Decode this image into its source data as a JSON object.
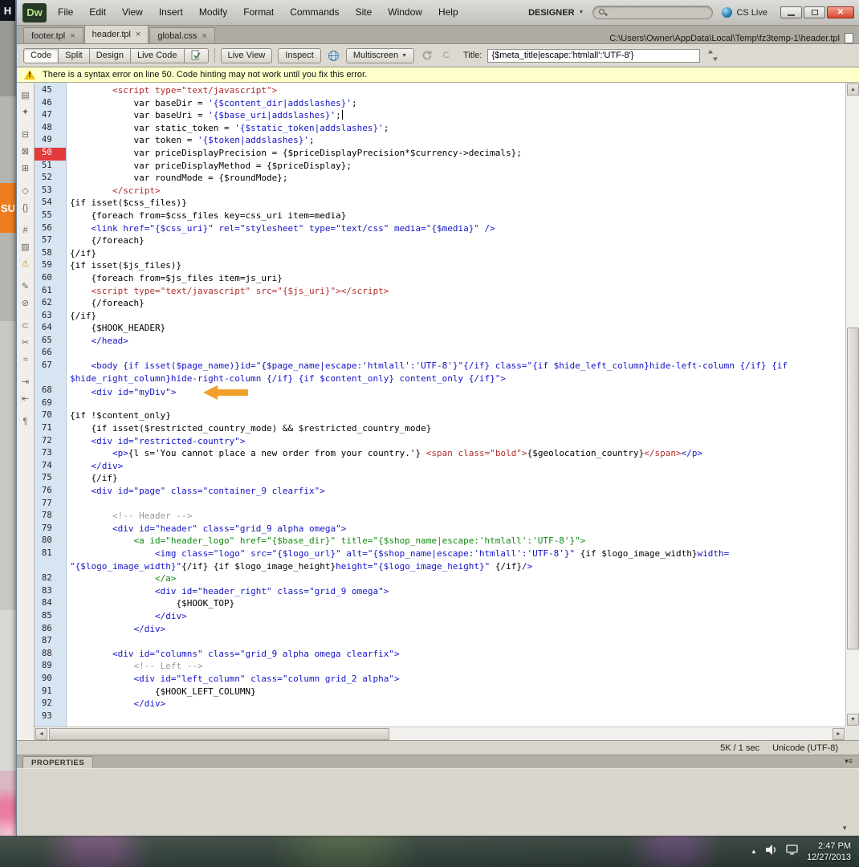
{
  "window": {
    "app_icon": "Dw",
    "menus": [
      "File",
      "Edit",
      "View",
      "Insert",
      "Modify",
      "Format",
      "Commands",
      "Site",
      "Window",
      "Help"
    ],
    "workspace": "DESIGNER",
    "cs_live": "CS Live"
  },
  "tabs": [
    {
      "label": "footer.tpl"
    },
    {
      "label": "header.tpl",
      "active": true
    },
    {
      "label": "global.css"
    }
  ],
  "path": "C:\\Users\\Owner\\AppData\\Local\\Temp\\fz3temp-1\\header.tpl",
  "toolbar": {
    "code": "Code",
    "split": "Split",
    "design": "Design",
    "live_code": "Live Code",
    "live_view": "Live View",
    "inspect": "Inspect",
    "multiscreen": "Multiscreen",
    "title_label": "Title:",
    "title_value": "{$meta_title|escape:'htmlall':'UTF-8'}",
    "validate_glyph": "C"
  },
  "warning": "There is a syntax error on line 50.  Code hinting may not work until you fix this error.",
  "status": {
    "size_time": "5K / 1 sec",
    "encoding": "Unicode (UTF-8)"
  },
  "properties_label": "PROPERTIES",
  "taskbar": {
    "time": "2:47 PM",
    "date": "12/27/2013"
  },
  "desktop": {
    "h_badge": "H",
    "su_badge": "SU"
  },
  "icons": {
    "tab_close": "×",
    "caret_down": "▼",
    "up": "▲",
    "down": "▼",
    "left": "◄",
    "right": "►",
    "panel_menu": "▾≡",
    "collapse": "▼",
    "tray_expand": "▲",
    "close": "✕"
  },
  "coding_toolbar": [
    {
      "name": "open-documents-icon",
      "glyph": "▤"
    },
    {
      "name": "code-navigator-icon",
      "glyph": "✦"
    },
    {
      "name": "collapse-full-tag-icon",
      "glyph": "⊟",
      "gap": true
    },
    {
      "name": "collapse-selection-icon",
      "glyph": "⊠"
    },
    {
      "name": "expand-all-icon",
      "glyph": "⊞"
    },
    {
      "name": "select-parent-tag-icon",
      "glyph": "◇",
      "gap": true
    },
    {
      "name": "balance-braces-icon",
      "glyph": "{}"
    },
    {
      "name": "line-numbers-icon",
      "glyph": "#",
      "gap": true
    },
    {
      "name": "highlight-invalid-code-icon",
      "glyph": "▨"
    },
    {
      "name": "syntax-error-alerts-icon",
      "glyph": "⚠",
      "accent": true
    },
    {
      "name": "apply-comment-icon",
      "glyph": "✎",
      "gap": true
    },
    {
      "name": "remove-comment-icon",
      "glyph": "⊘"
    },
    {
      "name": "wrap-tag-icon",
      "glyph": "⊂",
      "gap": true
    },
    {
      "name": "recent-snippets-icon",
      "glyph": "✂"
    },
    {
      "name": "move-convert-css-icon",
      "glyph": "≈"
    },
    {
      "name": "indent-code-icon",
      "glyph": "⇥",
      "gap": true
    },
    {
      "name": "outdent-code-icon",
      "glyph": "⇤"
    },
    {
      "name": "format-source-code-icon",
      "glyph": "¶",
      "gap": true
    }
  ],
  "code": {
    "error_line": 50,
    "lines": [
      {
        "n": 45,
        "seg": [
          [
            "red",
            "        <script type=\"text/javascript\">"
          ]
        ]
      },
      {
        "n": 46,
        "seg": [
          [
            "blk",
            "            var baseDir = "
          ],
          [
            "blu",
            "'{$content_dir|addslashes}'"
          ],
          [
            "blk",
            ";"
          ]
        ]
      },
      {
        "n": 47,
        "caret": true,
        "seg": [
          [
            "blk",
            "            var baseUri = "
          ],
          [
            "blu",
            "'{$base_uri|addslashes}'"
          ],
          [
            "blk",
            ";"
          ]
        ]
      },
      {
        "n": 48,
        "seg": [
          [
            "blk",
            "            var static_token = "
          ],
          [
            "blu",
            "'{$static_token|addslashes}'"
          ],
          [
            "blk",
            ";"
          ]
        ]
      },
      {
        "n": 49,
        "seg": [
          [
            "blk",
            "            var token = "
          ],
          [
            "blu",
            "'{$token|addslashes}'"
          ],
          [
            "blk",
            ";"
          ]
        ]
      },
      {
        "n": 50,
        "seg": [
          [
            "blk",
            "            var priceDisplayPrecision = {$priceDisplayPrecision*$currency->decimals};"
          ]
        ]
      },
      {
        "n": 51,
        "seg": [
          [
            "blk",
            "            var priceDisplayMethod = {$priceDisplay};"
          ]
        ]
      },
      {
        "n": 52,
        "seg": [
          [
            "blk",
            "            var roundMode = {$roundMode};"
          ]
        ]
      },
      {
        "n": 53,
        "seg": [
          [
            "red",
            "        </script>"
          ]
        ]
      },
      {
        "n": 54,
        "seg": [
          [
            "blk",
            "{if isset($css_files)}"
          ]
        ]
      },
      {
        "n": 55,
        "seg": [
          [
            "blk",
            "    {foreach from=$css_files key=css_uri item=media}"
          ]
        ]
      },
      {
        "n": 56,
        "seg": [
          [
            "blu",
            "    <link href=\"{$css_uri}\" rel=\"stylesheet\" type=\"text/css\" media=\"{$media}\" />"
          ]
        ]
      },
      {
        "n": 57,
        "seg": [
          [
            "blk",
            "    {/foreach}"
          ]
        ]
      },
      {
        "n": 58,
        "seg": [
          [
            "blk",
            "{/if}"
          ]
        ]
      },
      {
        "n": 59,
        "seg": [
          [
            "blk",
            "{if isset($js_files)}"
          ]
        ]
      },
      {
        "n": 60,
        "seg": [
          [
            "blk",
            "    {foreach from=$js_files item=js_uri}"
          ]
        ]
      },
      {
        "n": 61,
        "seg": [
          [
            "red",
            "    <script type=\"text/javascript\" src=\"{$js_uri}\"></script>"
          ]
        ]
      },
      {
        "n": 62,
        "seg": [
          [
            "blk",
            "    {/foreach}"
          ]
        ]
      },
      {
        "n": 63,
        "seg": [
          [
            "blk",
            "{/if}"
          ]
        ]
      },
      {
        "n": 64,
        "seg": [
          [
            "blk",
            "    {$HOOK_HEADER}"
          ]
        ]
      },
      {
        "n": 65,
        "seg": [
          [
            "blu",
            "    </head>"
          ]
        ]
      },
      {
        "n": 66,
        "seg": []
      },
      {
        "n": 67,
        "seg": [
          [
            "blu",
            "    <body {if isset($page_name)}id=\"{$page_name|escape:'htmlall':'UTF-8'}\"{/if} class=\"{if $hide_left_column}hide-left-column {/if} {if"
          ]
        ]
      },
      {
        "n": null,
        "seg": [
          [
            "blu",
            "$hide_right_column}hide-right-column {/if} {if $content_only} content_only {/if}\">"
          ]
        ]
      },
      {
        "n": 68,
        "arrow": true,
        "seg": [
          [
            "blu",
            "    <div id=\"myDiv\">"
          ]
        ]
      },
      {
        "n": 69,
        "seg": []
      },
      {
        "n": 70,
        "seg": [
          [
            "blk",
            "{if !$content_only}"
          ]
        ]
      },
      {
        "n": 71,
        "seg": [
          [
            "blk",
            "    {if isset($restricted_country_mode) && $restricted_country_mode}"
          ]
        ]
      },
      {
        "n": 72,
        "seg": [
          [
            "blu",
            "    <div id=\"restricted-country\">"
          ]
        ]
      },
      {
        "n": 73,
        "seg": [
          [
            "blu",
            "        <p>"
          ],
          [
            "blk",
            "{l s='You cannot place a new order from your country.'} "
          ],
          [
            "red",
            "<span class=\"bold\">"
          ],
          [
            "blk",
            "{$geolocation_country}"
          ],
          [
            "red",
            "</span>"
          ],
          [
            "blu",
            "</p>"
          ]
        ]
      },
      {
        "n": 74,
        "seg": [
          [
            "blu",
            "    </div>"
          ]
        ]
      },
      {
        "n": 75,
        "seg": [
          [
            "blk",
            "    {/if}"
          ]
        ]
      },
      {
        "n": 76,
        "seg": [
          [
            "blu",
            "    <div id=\"page\" class=\"container_9 clearfix\">"
          ]
        ]
      },
      {
        "n": 77,
        "seg": []
      },
      {
        "n": 78,
        "seg": [
          [
            "gry",
            "        <!-- Header -->"
          ]
        ]
      },
      {
        "n": 79,
        "seg": [
          [
            "blu",
            "        <div id=\"header\" class=\"grid_9 alpha omega\">"
          ]
        ]
      },
      {
        "n": 80,
        "seg": [
          [
            "grn",
            "            <a id=\"header_logo\" href=\"{$base_dir}\" title=\"{$shop_name|escape:'htmlall':'UTF-8'}\">"
          ]
        ]
      },
      {
        "n": 81,
        "seg": [
          [
            "blu",
            "                <img class=\"logo\" src=\"{$logo_url}\" alt=\"{$shop_name|escape:'htmlall':'UTF-8'}\" "
          ],
          [
            "blk",
            "{if $logo_image_width}"
          ],
          [
            "blu",
            "width="
          ]
        ]
      },
      {
        "n": null,
        "seg": [
          [
            "blu",
            "\"{$logo_image_width}\""
          ],
          [
            "blk",
            "{/if} {if $logo_image_height}"
          ],
          [
            "blu",
            "height=\"{$logo_image_height}\" "
          ],
          [
            "blk",
            "{/if}"
          ],
          [
            "blu",
            "/>"
          ]
        ]
      },
      {
        "n": 82,
        "seg": [
          [
            "grn",
            "                </a>"
          ]
        ]
      },
      {
        "n": 83,
        "seg": [
          [
            "blu",
            "                <div id=\"header_right\" class=\"grid_9 omega\">"
          ]
        ]
      },
      {
        "n": 84,
        "seg": [
          [
            "blk",
            "                    {$HOOK_TOP}"
          ]
        ]
      },
      {
        "n": 85,
        "seg": [
          [
            "blu",
            "                </div>"
          ]
        ]
      },
      {
        "n": 86,
        "seg": [
          [
            "blu",
            "            </div>"
          ]
        ]
      },
      {
        "n": 87,
        "seg": []
      },
      {
        "n": 88,
        "seg": [
          [
            "blu",
            "        <div id=\"columns\" class=\"grid_9 alpha omega clearfix\">"
          ]
        ]
      },
      {
        "n": 89,
        "seg": [
          [
            "gry",
            "            <!-- Left -->"
          ]
        ]
      },
      {
        "n": 90,
        "seg": [
          [
            "blu",
            "            <div id=\"left_column\" class=\"column grid_2 alpha\">"
          ]
        ]
      },
      {
        "n": 91,
        "seg": [
          [
            "blk",
            "                {$HOOK_LEFT_COLUMN}"
          ]
        ]
      },
      {
        "n": 92,
        "seg": [
          [
            "blu",
            "            </div>"
          ]
        ]
      },
      {
        "n": 93,
        "seg": []
      }
    ]
  }
}
